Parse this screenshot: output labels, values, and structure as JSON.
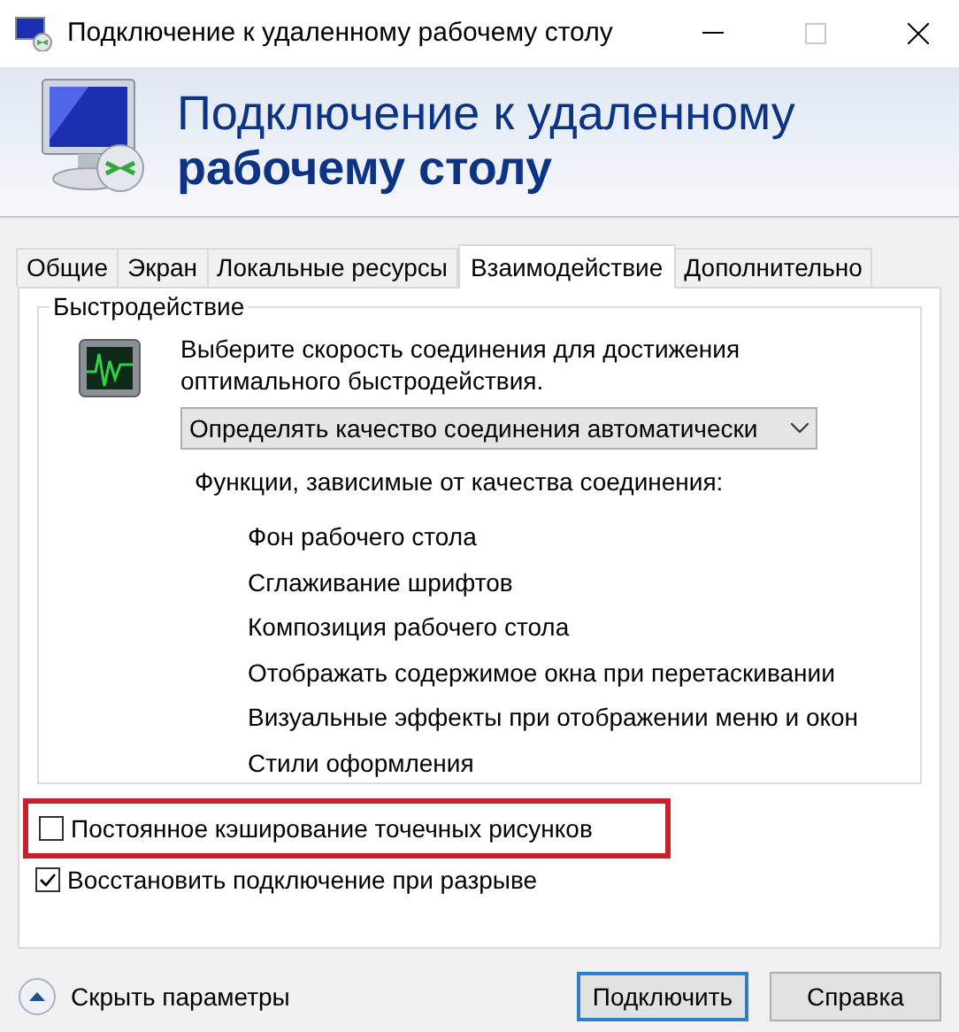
{
  "window": {
    "title": "Подключение к удаленному рабочему столу"
  },
  "header": {
    "line1": "Подключение к удаленному",
    "line2": "рабочему столу"
  },
  "tabs": [
    {
      "label": "Общие",
      "selected": false
    },
    {
      "label": "Экран",
      "selected": false
    },
    {
      "label": "Локальные ресурсы",
      "selected": false
    },
    {
      "label": "Взаимодействие",
      "selected": true
    },
    {
      "label": "Дополнительно",
      "selected": false
    }
  ],
  "performance": {
    "title": "Быстродействие",
    "description": "Выберите скорость соединения для достижения оптимального быстродействия.",
    "connection_select": {
      "value": "Определять качество соединения автоматически"
    },
    "features_label": "Функции, зависимые от качества соединения:",
    "features": [
      "Фон рабочего стола",
      "Сглаживание шрифтов",
      "Композиция рабочего стола",
      "Отображать содержимое окна при перетаскивании",
      "Визуальные эффекты при отображении меню и окон",
      "Стили оформления"
    ]
  },
  "options": [
    {
      "label": "Постоянное кэширование точечных рисунков",
      "checked": false,
      "highlighted": true
    },
    {
      "label": "Восстановить подключение при разрыве",
      "checked": true,
      "highlighted": false
    }
  ],
  "footer": {
    "toggle": "Скрыть параметры",
    "buttons": [
      {
        "label": "Подключить",
        "default": true
      },
      {
        "label": "Справка",
        "default": false
      }
    ]
  }
}
